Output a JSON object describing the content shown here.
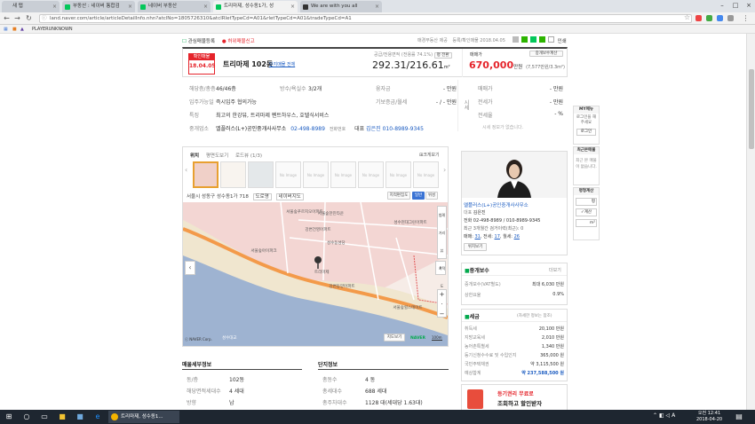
{
  "browser": {
    "tabs": [
      {
        "label": "새 탭"
      },
      {
        "label": "부동산 : 네이버 통합검"
      },
      {
        "label": "네이버 부동산"
      },
      {
        "label": "트리마제, 성수동1가, 성"
      },
      {
        "label": "We are with you all"
      }
    ],
    "url": "land.naver.com/article/articleDetailInfo.nhn?atclNo=1805726310&atclRletTypeCd=A01&rletTypeCd=A01&tradeTypeCd=A1",
    "bookmark": "PLAYERUNKNOWN"
  },
  "listing": {
    "top_actions": {
      "favorite": "관심매물등록",
      "report": "허위매물신고"
    },
    "meta": {
      "confirm": "매경부동산 제공",
      "date_label": "등록/확인매물 2018.04.05"
    },
    "print": "인쇄",
    "stamp": {
      "title": "확인매물",
      "date": "18.04.05"
    },
    "name": "트리마제 102동",
    "name_link": "단지매물 전체",
    "area": {
      "label": "공급/전용면적",
      "note": "(전용률 74.1%)",
      "toggle": "평 전환",
      "supply": "292.31",
      "exclusive": "216.61",
      "unit": "m²"
    },
    "price": {
      "label": "매매가",
      "value": "670,000",
      "unit": "만원",
      "per": "(7,577만원/3.3m²)",
      "tax_button": "중개보수계산"
    },
    "details": [
      {
        "label": "해당층/총층",
        "value": "46/46층"
      },
      {
        "label": "입주가능일",
        "value": "즉시입주 협의가능"
      },
      {
        "label": "특징",
        "value": "최고의 한강뷰, 트리마제 펜트하우스, 호텔식서비스"
      },
      {
        "label": "중개업소",
        "value": "엘플러스(L+)공인중개사사무소"
      }
    ],
    "details_mid": [
      {
        "label": "방수/욕실수",
        "value": "3/2개"
      }
    ],
    "details_right": [
      {
        "label": "융자금",
        "value": "- 만원"
      },
      {
        "label": "기보증금/월세",
        "value": "- / - 만원"
      }
    ],
    "agent_phone": "02-498-8989",
    "agent_more": "전화번호",
    "agent_contact_label": "대표",
    "agent_contact": "김은진 010-8989-9345",
    "sise": {
      "side_label": "시세",
      "rows": [
        {
          "label": "매매가",
          "value": "- 만원"
        },
        {
          "label": "전세가",
          "value": "- 만원"
        },
        {
          "label": "전세율",
          "value": "- %"
        }
      ],
      "note": "시세 정보가 없습니다."
    }
  },
  "location": {
    "tabs": [
      "위치",
      "평면도보기",
      "로드뷰 (1/3)"
    ],
    "thumb_label": "No Image",
    "zoom_link": "크게보기",
    "address": "서울시 성동구 성수동1가 718",
    "address_select": "도로명",
    "address_copy": "네이버지도",
    "map_buttons": [
      "지적편집도",
      "일반",
      "위성"
    ],
    "map_labels": [
      "서울숲푸르지오아파트",
      "서울숲한진타운",
      "강변건영아파트",
      "성수현대그린아파트",
      "성수동성당",
      "서울숲아이파크",
      "트리마제",
      "강변동양아파트",
      "서울숲힐스테이트",
      "성수대교"
    ],
    "map_sidebar": [
      "범례",
      "거리뷰",
      "지적도"
    ],
    "map_copyright": "ⓒ NAVER Corp.",
    "map_button_route": "지도보기",
    "naver": "NAVER",
    "scale": "100m"
  },
  "sections": {
    "left": {
      "title": "매물세부정보",
      "rows": [
        {
          "label": "동/층",
          "value": "102동"
        },
        {
          "label": "해당면적세대수",
          "value": "4 세대"
        },
        {
          "label": "방향",
          "value": "남"
        }
      ]
    },
    "right": {
      "title": "단지정보",
      "rows": [
        {
          "label": "총동수",
          "value": "4 동"
        },
        {
          "label": "총세대수",
          "value": "688 세대"
        },
        {
          "label": "총주차대수",
          "value": "1128 대(세대당 1.63대)"
        }
      ]
    }
  },
  "agent_card": {
    "name": "엘플러스(L+)공인중개사사무소",
    "rep_label": "대표",
    "rep": "김은진",
    "tel": "전화 02-498-8989 / 010-8989-9345",
    "records": "최근 3개월간 검거이력(최근): 0",
    "counts": [
      {
        "label": "매매",
        "value": "31"
      },
      {
        "label": "전세",
        "value": "17"
      },
      {
        "label": "월세",
        "value": "26"
      }
    ],
    "more": "위치보기"
  },
  "brokerage": {
    "title": "중개보수",
    "more": "더보기",
    "rows": [
      {
        "label": "중개보수(VAT별도)",
        "value": "최대 6,030 만원"
      },
      {
        "label": "상한요율",
        "value": "0.9%"
      }
    ]
  },
  "tax": {
    "title": "세금",
    "sub": "(자세한 정보는 참조)",
    "rows": [
      {
        "label": "취득세",
        "value": "20,100 만원"
      },
      {
        "label": "지방교육세",
        "value": "2,010 만원"
      },
      {
        "label": "농어촌특별세",
        "value": "1,340 만원"
      },
      {
        "label": "등기신청수수료 및 수입인지",
        "value": "365,000 원"
      },
      {
        "label": "국민주택채권",
        "value": "약 3,115,500 원"
      },
      {
        "label": "예상합계",
        "value": "약 237,588,500 원"
      }
    ]
  },
  "ad": {
    "line1": "등기권리 무료로",
    "line2": "조회하고 할인받자"
  },
  "right_rail": {
    "mymenu": {
      "title": "MY메뉴",
      "text": "로그인을 해주세요",
      "button": "로그인"
    },
    "recent": {
      "title": "최근본매물",
      "text": "최근 본 매물이 없습니다."
    },
    "calc": {
      "title": "평형계산",
      "unit": "평",
      "button": "계산",
      "unit2": "m²"
    }
  },
  "taskbar": {
    "app": "트리마제, 성수동1...",
    "time": "오전 12:41",
    "date": "2018-04-20"
  }
}
